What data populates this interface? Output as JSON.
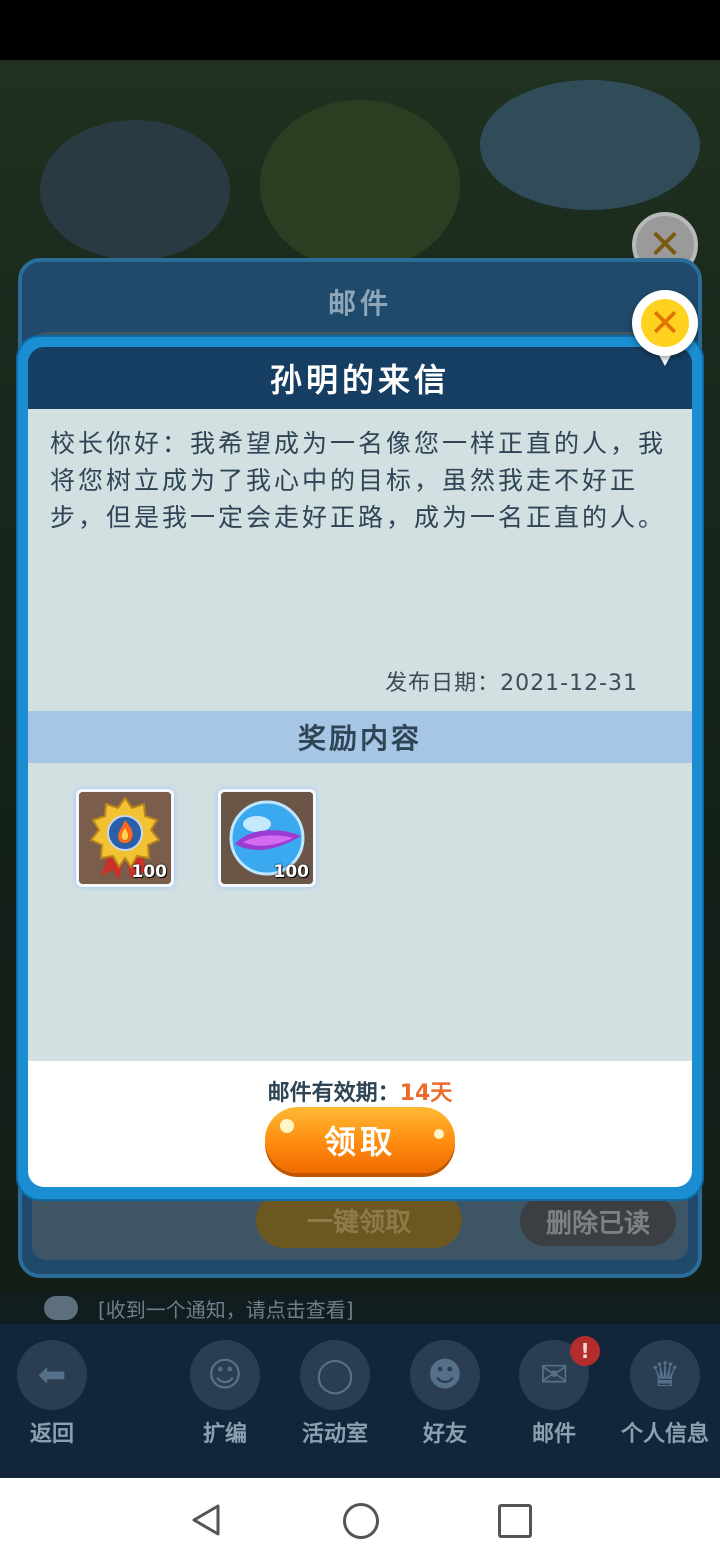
{
  "background": {
    "mail_window_title": "邮件",
    "claim_all_label": "一键领取",
    "delete_read_label": "删除已读",
    "notice_text": "[收到一个通知，请点击查看]"
  },
  "bottom_nav": {
    "items": [
      {
        "label": "返回",
        "icon": "back-arrow-icon"
      },
      {
        "label": "扩编",
        "icon": "expand-icon"
      },
      {
        "label": "活动室",
        "icon": "activity-room-icon"
      },
      {
        "label": "好友",
        "icon": "friends-icon"
      },
      {
        "label": "邮件",
        "icon": "mail-icon",
        "badge": "!"
      },
      {
        "label": "个人信息",
        "icon": "profile-icon"
      }
    ]
  },
  "dialog": {
    "title": "孙明的来信",
    "message": "校长你好：我希望成为一名像您一样正直的人，我将您树立成为了我心中的目标，虽然我走不好正步，但是我一定会走好正路，成为一名正直的人。",
    "publish_date": "发布日期：2021-12-31",
    "reward_header": "奖励内容",
    "rewards": [
      {
        "icon": "medal-icon",
        "quantity": "100"
      },
      {
        "icon": "crystal-orb-icon",
        "quantity": "100"
      }
    ],
    "validity_label": "邮件有效期：",
    "validity_days": "14天",
    "claim_label": "领取"
  },
  "colors": {
    "dialog_border": "#1b8ed1",
    "header_bg": "#163e63",
    "panel_bg": "#d2e0e1",
    "reward_header_bg": "#a7c6e6",
    "accent_orange": "#ff8b10",
    "validity_days": "#ec6b2c"
  }
}
